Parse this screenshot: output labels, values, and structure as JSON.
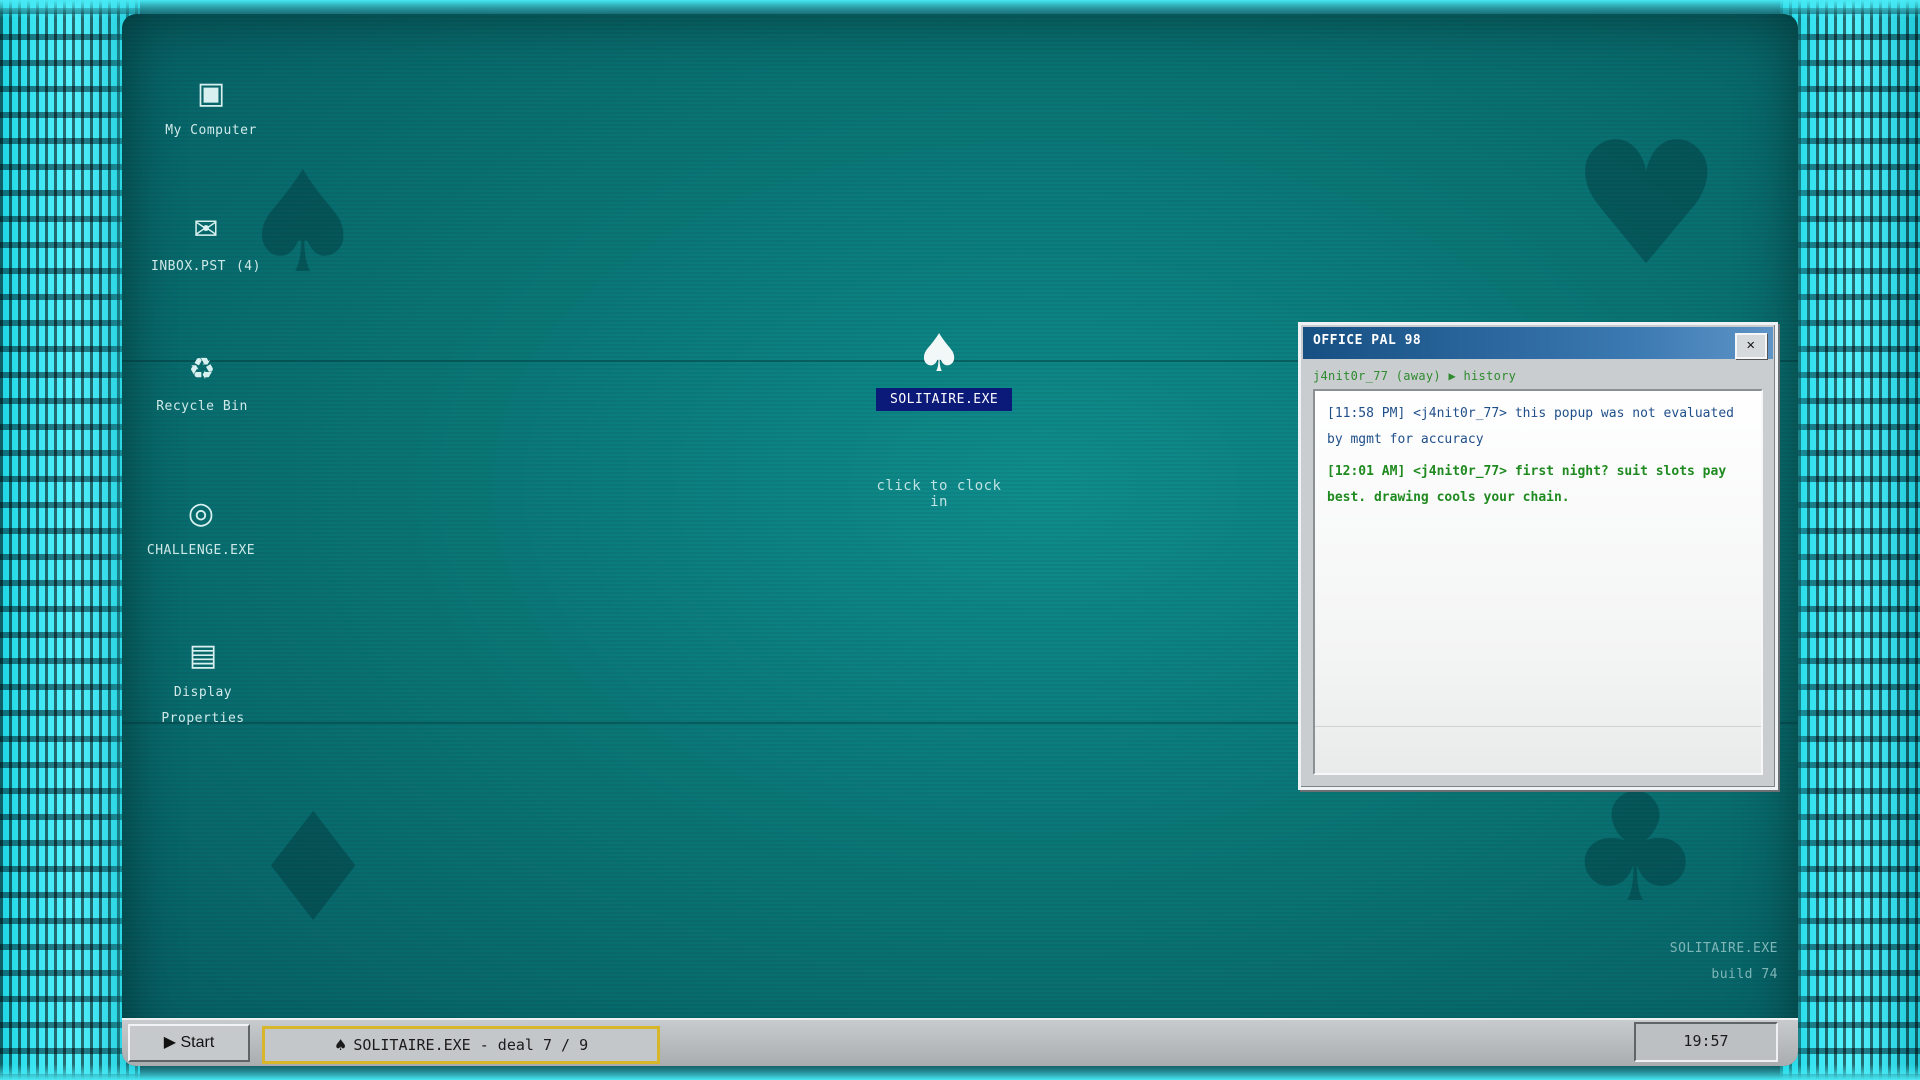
{
  "desktop": {
    "icons": [
      {
        "label": "My Computer",
        "glyph": "▣",
        "icon": "computer-icon"
      },
      {
        "label": "INBOX.PST",
        "count": "(4)",
        "glyph": "✉",
        "icon": "mail-icon"
      },
      {
        "label": "Recycle Bin",
        "glyph": "♻",
        "icon": "recycle-icon"
      },
      {
        "label": "CHALLENGE.EXE",
        "glyph": "◎",
        "icon": "target-icon"
      },
      {
        "label_line1": "Display",
        "label_line2": "Properties",
        "glyph": "▤",
        "icon": "display-icon"
      }
    ],
    "center_app": {
      "glyph": "♠",
      "label": "SOLITAIRE.EXE"
    },
    "hint": "click to clock in",
    "watermarks": {
      "spade": "♠",
      "heart": "♥",
      "diamond": "♦",
      "club": "♣"
    }
  },
  "chat": {
    "title": "OFFICE PAL 98",
    "close_label": "✕",
    "breadcrumb": "j4nit0r_77 (away) ▶ history",
    "messages": [
      "[11:58 PM] <j4nit0r_77> this popup was not evaluated by mgmt for accuracy",
      "[12:01 AM] <j4nit0r_77> first night? suit slots pay best. drawing cools your chain."
    ]
  },
  "build": {
    "line1": "SOLITAIRE.EXE",
    "line2": "build 74"
  },
  "taskbar": {
    "start_label": "▶ Start",
    "task_glyph": "♠",
    "task_label": "SOLITAIRE.EXE - deal 7 / 9",
    "clock": "19:57"
  },
  "colors": {
    "desktop": "#0a7676",
    "selection": "#0b1a78",
    "crt_glow": "#49eaf5",
    "chat_title": "#164f82",
    "task_highlight": "#d8b62a"
  }
}
